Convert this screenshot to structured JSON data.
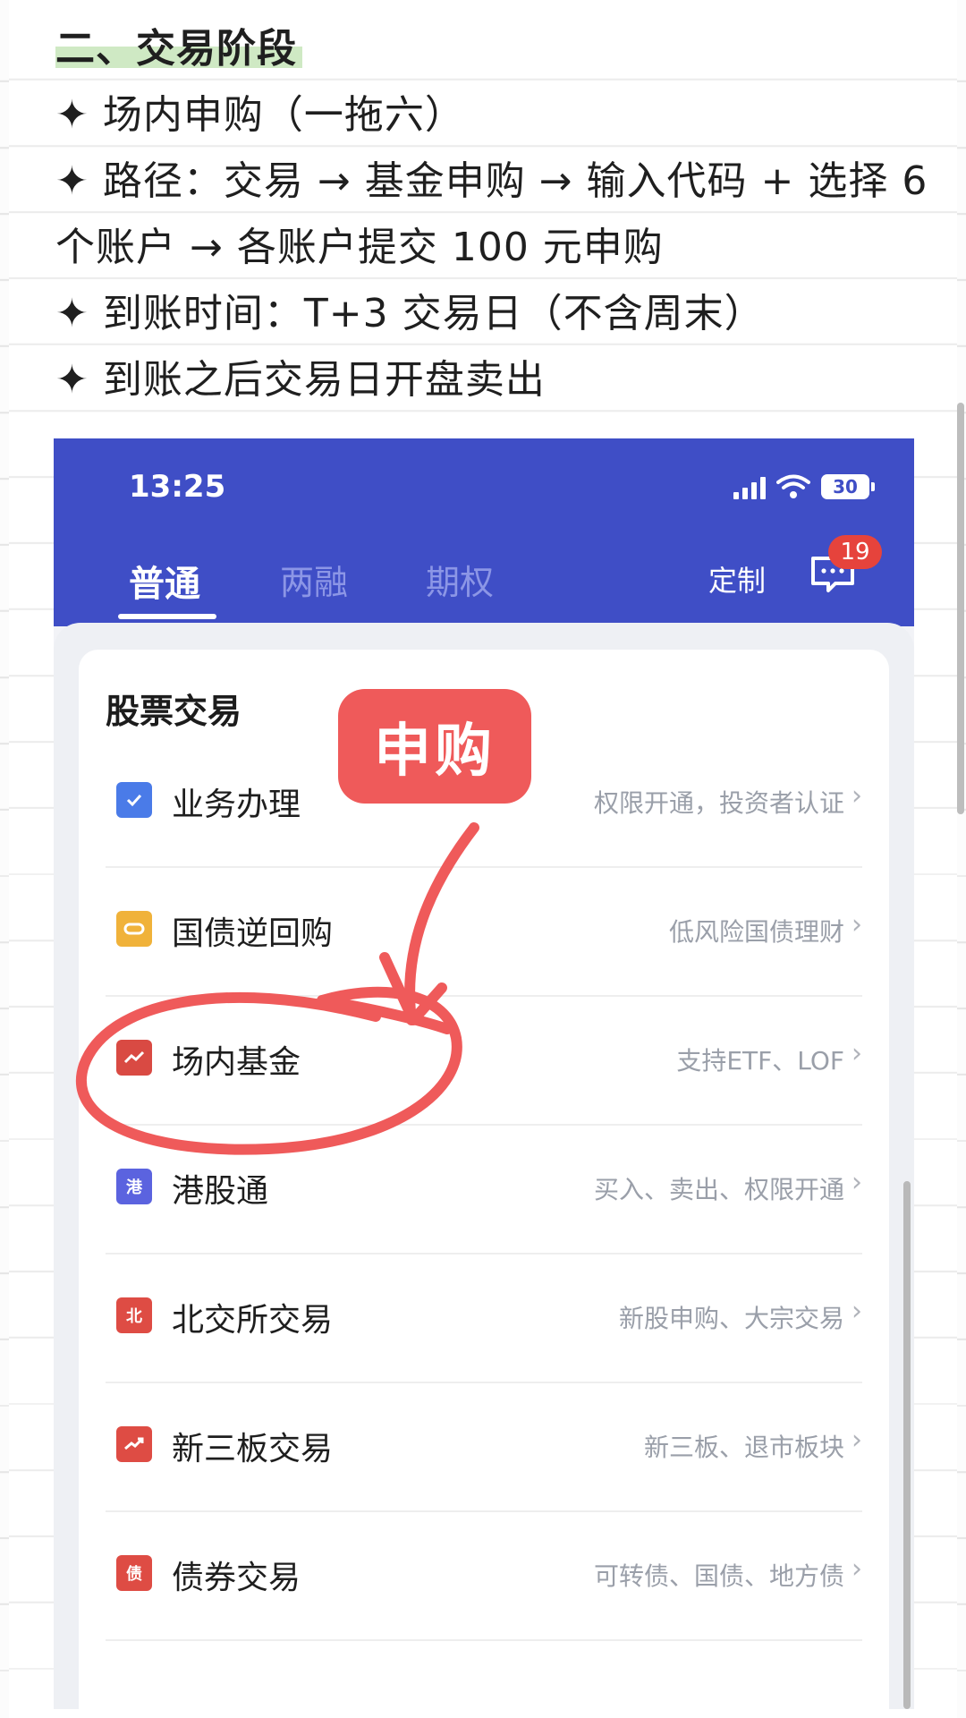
{
  "note": {
    "title": "二、交易阶段",
    "lines": [
      "✦ 场内申购（一拖六）",
      "✦ 路径：交易 → 基金申购 → 输入代码 + 选择 6",
      "个账户 → 各账户提交 100 元申购",
      "✦ 到账时间：T+3 交易日（不含周末）",
      "✦ 到账之后交易日开盘卖出"
    ]
  },
  "phone": {
    "status": {
      "time": "13:25",
      "battery": "30"
    },
    "tabs": [
      "普通",
      "两融",
      "期权"
    ],
    "custom_label": "定制",
    "message_badge": "19",
    "section_title": "股票交易",
    "items": [
      {
        "label": "业务办理",
        "desc": "权限开通，投资者认证",
        "icon": "clipboard-check-icon",
        "color": "#4a7be8"
      },
      {
        "label": "国债逆回购",
        "desc": "低风险国债理财",
        "icon": "bond-repo-icon",
        "color": "#f0b23a"
      },
      {
        "label": "场内基金",
        "desc": "支持ETF、LOF",
        "icon": "fund-chart-icon",
        "color": "#d94a43"
      },
      {
        "label": "港股通",
        "desc": "买入、卖出、权限开通",
        "icon": "港",
        "color": "#5b63df"
      },
      {
        "label": "北交所交易",
        "desc": "新股申购、大宗交易",
        "icon": "北",
        "color": "#de4c44"
      },
      {
        "label": "新三板交易",
        "desc": "新三板、退市板块",
        "icon": "trend-board-icon",
        "color": "#de4c44"
      },
      {
        "label": "债券交易",
        "desc": "可转债、国债、地方债",
        "icon": "债",
        "color": "#de4c44"
      }
    ]
  },
  "annotation": {
    "callout": "申购",
    "color": "#ef5a5a"
  }
}
